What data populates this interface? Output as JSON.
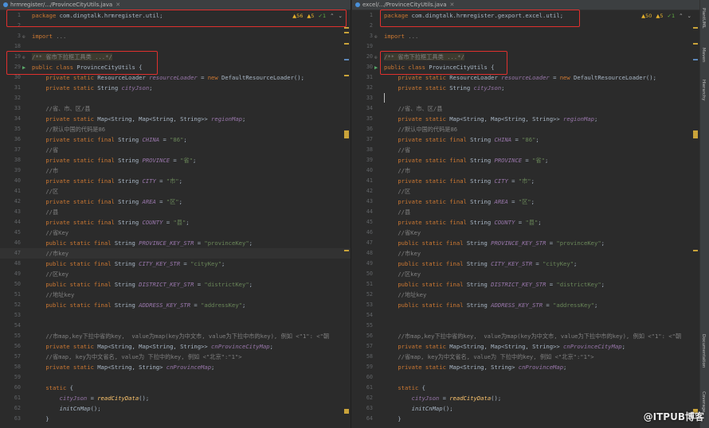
{
  "left": {
    "tab_title": "hrmregister/.../ProvinceCityUtils.java",
    "warnings": {
      "w1": "56",
      "w2": "5",
      "ok": "1"
    },
    "lines": [
      {
        "n": "1",
        "html": "<span class=\"kw\">package</span> com.dingtalk.hrmregister.util;"
      },
      {
        "n": "2",
        "html": ""
      },
      {
        "n": "3",
        "html": "<span class=\"kw\">import</span> <span class=\"cm\">...</span>"
      },
      {
        "n": "18",
        "html": ""
      },
      {
        "n": "19",
        "html": "<span class=\"cm fold-block\">/** 省市下拉框工具类 ...*/</span>"
      },
      {
        "n": "29",
        "html": "<span class=\"kw\">public class</span> ProvinceCityUtils {"
      },
      {
        "n": "30",
        "html": "    <span class=\"kw\">private static</span> ResourceLoader <span class=\"fld\">resourceLoader</span> = <span class=\"kw\">new</span> DefaultResourceLoader();"
      },
      {
        "n": "31",
        "html": "    <span class=\"kw\">private static</span> String <span class=\"fld\">cityJson</span>;"
      },
      {
        "n": "32",
        "html": ""
      },
      {
        "n": "33",
        "html": "    <span class=\"cm\">//省、市、区/县</span>"
      },
      {
        "n": "34",
        "html": "    <span class=\"kw\">private static</span> Map&lt;String, Map&lt;String, String&gt;&gt; <span class=\"fld\">regionMap</span>;"
      },
      {
        "n": "35",
        "html": "    <span class=\"cm\">//默认中国的代码是86</span>"
      },
      {
        "n": "36",
        "html": "    <span class=\"kw\">private static final</span> String <span class=\"fld\">CHINA</span> = <span class=\"st\">\"86\"</span>;"
      },
      {
        "n": "37",
        "html": "    <span class=\"cm\">//省</span>"
      },
      {
        "n": "38",
        "html": "    <span class=\"kw\">private static final</span> String <span class=\"fld\">PROVINCE</span> = <span class=\"st\">\"省\"</span>;"
      },
      {
        "n": "39",
        "html": "    <span class=\"cm\">//市</span>"
      },
      {
        "n": "40",
        "html": "    <span class=\"kw\">private static final</span> String <span class=\"fld\">CITY</span> = <span class=\"st\">\"市\"</span>;"
      },
      {
        "n": "41",
        "html": "    <span class=\"cm\">//区</span>"
      },
      {
        "n": "42",
        "html": "    <span class=\"kw\">private static final</span> String <span class=\"fld\">AREA</span> = <span class=\"st\">\"区\"</span>;"
      },
      {
        "n": "43",
        "html": "    <span class=\"cm\">//县</span>"
      },
      {
        "n": "44",
        "html": "    <span class=\"kw\">private static final</span> String <span class=\"fld\">COUNTY</span> = <span class=\"st\">\"县\"</span>;"
      },
      {
        "n": "45",
        "html": "    <span class=\"cm\">//省Key</span>"
      },
      {
        "n": "46",
        "html": "    <span class=\"kw\">public static final</span> String <span class=\"fld\">PROVINCE_KEY_STR</span> = <span class=\"st\">\"provinceKey\"</span>;"
      },
      {
        "n": "47",
        "html": "    <span class=\"cm\">//市key</span>",
        "hl": true
      },
      {
        "n": "48",
        "html": "    <span class=\"kw\">public static final</span> String <span class=\"fld\">CITY_KEY_STR</span> = <span class=\"st\">\"cityKey\"</span>;"
      },
      {
        "n": "49",
        "html": "    <span class=\"cm\">//区key</span>"
      },
      {
        "n": "50",
        "html": "    <span class=\"kw\">public static final</span> String <span class=\"fld\">DISTRICT_KEY_STR</span> = <span class=\"st\">\"districtKey\"</span>;"
      },
      {
        "n": "51",
        "html": "    <span class=\"cm\">//地址key</span>"
      },
      {
        "n": "52",
        "html": "    <span class=\"kw\">public static final</span> String <span class=\"fld\">ADDRESS_KEY_STR</span> = <span class=\"st\">\"addressKey\"</span>;"
      },
      {
        "n": "53",
        "html": ""
      },
      {
        "n": "54",
        "html": ""
      },
      {
        "n": "55",
        "html": "    <span class=\"cm\">//市map,key下拉中省的key,  value为map(key为中文市, value为下拉中市的key), 例如 &lt;\"1\": &lt;\"朝</span>"
      },
      {
        "n": "56",
        "html": "    <span class=\"kw\">private static</span> Map&lt;String, Map&lt;String, String&gt;&gt; <span class=\"fld\">cnProvinceCityMap</span>;"
      },
      {
        "n": "57",
        "html": "    <span class=\"cm\">//省map, key为中文省名, value为 下拉中的key, 例如 &lt;\"北京\":\"1\"&gt;</span>"
      },
      {
        "n": "58",
        "html": "    <span class=\"kw\">private static</span> Map&lt;String, String&gt; <span class=\"fld\">cnProvinceMap</span>;"
      },
      {
        "n": "59",
        "html": ""
      },
      {
        "n": "60",
        "html": "    <span class=\"kw\">static</span> {"
      },
      {
        "n": "61",
        "html": "        <span class=\"fld\">cityJson</span> = <span class=\"mth\" style=\"font-style:italic\">readCityData</span>();"
      },
      {
        "n": "62",
        "html": "        <span style=\"font-style:italic\">initCnMap</span>();"
      },
      {
        "n": "63",
        "html": "    }"
      }
    ]
  },
  "right": {
    "tab_title": "excel/.../ProvinceCityUtils.java",
    "warnings": {
      "w1": "50",
      "w2": "5",
      "ok": "1"
    },
    "lines": [
      {
        "n": "1",
        "html": "<span class=\"kw\">package</span> com.dingtalk.hrmregister.gexport.excel.util;"
      },
      {
        "n": "2",
        "html": ""
      },
      {
        "n": "3",
        "html": "<span class=\"kw\">import</span> <span class=\"cm\">...</span>"
      },
      {
        "n": "19",
        "html": ""
      },
      {
        "n": "20",
        "html": "<span class=\"cm fold-block\">/** 省市下拉框工具类 ...*/</span>"
      },
      {
        "n": "30",
        "html": "<span class=\"kw\">public class</span> ProvinceCityUtils {"
      },
      {
        "n": "31",
        "html": "    <span class=\"kw\">private static</span> ResourceLoader <span class=\"fld\">resourceLoader</span> = <span class=\"kw\">new</span> DefaultResourceLoader();"
      },
      {
        "n": "32",
        "html": "    <span class=\"kw\">private static</span> String <span class=\"fld\">cityJson</span>;"
      },
      {
        "n": "33",
        "html": "",
        "caret": true
      },
      {
        "n": "34",
        "html": "    <span class=\"cm\">//省、市、区/县</span>"
      },
      {
        "n": "35",
        "html": "    <span class=\"kw\">private static</span> Map&lt;String, Map&lt;String, String&gt;&gt; <span class=\"fld\">regionMap</span>;"
      },
      {
        "n": "36",
        "html": "    <span class=\"cm\">//默认中国的代码是86</span>"
      },
      {
        "n": "37",
        "html": "    <span class=\"kw\">private static final</span> String <span class=\"fld\">CHINA</span> = <span class=\"st\">\"86\"</span>;"
      },
      {
        "n": "38",
        "html": "    <span class=\"cm\">//省</span>"
      },
      {
        "n": "39",
        "html": "    <span class=\"kw\">private static final</span> String <span class=\"fld\">PROVINCE</span> = <span class=\"st\">\"省\"</span>;"
      },
      {
        "n": "40",
        "html": "    <span class=\"cm\">//市</span>"
      },
      {
        "n": "41",
        "html": "    <span class=\"kw\">private static final</span> String <span class=\"fld\">CITY</span> = <span class=\"st\">\"市\"</span>;"
      },
      {
        "n": "42",
        "html": "    <span class=\"cm\">//区</span>"
      },
      {
        "n": "43",
        "html": "    <span class=\"kw\">private static final</span> String <span class=\"fld\">AREA</span> = <span class=\"st\">\"区\"</span>;"
      },
      {
        "n": "44",
        "html": "    <span class=\"cm\">//县</span>"
      },
      {
        "n": "45",
        "html": "    <span class=\"kw\">private static final</span> String <span class=\"fld\">COUNTY</span> = <span class=\"st\">\"县\"</span>;"
      },
      {
        "n": "46",
        "html": "    <span class=\"cm\">//省Key</span>"
      },
      {
        "n": "47",
        "html": "    <span class=\"kw\">public static final</span> String <span class=\"fld\">PROVINCE_KEY_STR</span> = <span class=\"st\">\"provinceKey\"</span>;"
      },
      {
        "n": "48",
        "html": "    <span class=\"cm\">//市key</span>"
      },
      {
        "n": "49",
        "html": "    <span class=\"kw\">public static final</span> String <span class=\"fld\">CITY_KEY_STR</span> = <span class=\"st\">\"cityKey\"</span>;"
      },
      {
        "n": "50",
        "html": "    <span class=\"cm\">//区key</span>"
      },
      {
        "n": "51",
        "html": "    <span class=\"kw\">public static final</span> String <span class=\"fld\">DISTRICT_KEY_STR</span> = <span class=\"st\">\"districtKey\"</span>;"
      },
      {
        "n": "52",
        "html": "    <span class=\"cm\">//地址key</span>"
      },
      {
        "n": "53",
        "html": "    <span class=\"kw\">public static final</span> String <span class=\"fld\">ADDRESS_KEY_STR</span> = <span class=\"st\">\"addressKey\"</span>;"
      },
      {
        "n": "54",
        "html": ""
      },
      {
        "n": "55",
        "html": ""
      },
      {
        "n": "56",
        "html": "    <span class=\"cm\">//市map,key下拉中省的key,  value为map(key为中文市, value为下拉中市的key), 例如 &lt;\"1\": &lt;\"朝</span>"
      },
      {
        "n": "57",
        "html": "    <span class=\"kw\">private static</span> Map&lt;String, Map&lt;String, String&gt;&gt; <span class=\"fld\">cnProvinceCityMap</span>;"
      },
      {
        "n": "58",
        "html": "    <span class=\"cm\">//省map, key为中文省名, value为 下拉中的key, 例如 &lt;\"北京\":\"1\"&gt;</span>"
      },
      {
        "n": "59",
        "html": "    <span class=\"kw\">private static</span> Map&lt;String, String&gt; <span class=\"fld\">cnProvinceMap</span>;"
      },
      {
        "n": "60",
        "html": ""
      },
      {
        "n": "61",
        "html": "    <span class=\"kw\">static</span> {"
      },
      {
        "n": "62",
        "html": "        <span class=\"fld\">cityJson</span> = <span class=\"mth\" style=\"font-style:italic\">readCityData</span>();"
      },
      {
        "n": "63",
        "html": "        <span style=\"font-style:italic\">initCnMap</span>();"
      },
      {
        "n": "64",
        "html": "    }"
      }
    ]
  },
  "sidebar": {
    "labels": [
      "PlantUML",
      "Maven",
      "Hierarchy",
      "Documentation",
      "Coverage"
    ]
  },
  "watermark": "@ITPUB博客",
  "colors": {
    "highlight_box": "#e0302e",
    "keyword": "#cc7832",
    "string": "#6a8759",
    "field": "#9876aa"
  }
}
